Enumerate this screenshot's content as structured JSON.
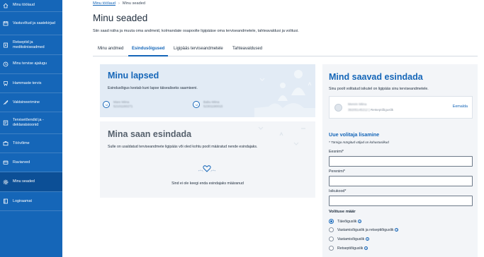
{
  "sidebar": {
    "items": [
      {
        "label": "Minu töölaud",
        "icon": "home-icon"
      },
      {
        "label": "Vastuvõtud ja saatekirjad",
        "icon": "calendar-icon"
      },
      {
        "label": "Retseptid ja meditsiiniseadmed",
        "icon": "prescription-icon"
      },
      {
        "label": "Minu tervise ajalugu",
        "icon": "history-icon"
      },
      {
        "label": "Hammaste tervis",
        "icon": "tooth-icon"
      },
      {
        "label": "Vaktsineerimine",
        "icon": "syringe-icon"
      },
      {
        "label": "Tervisetõendid ja -deklaratsioonid",
        "icon": "certificate-icon"
      },
      {
        "label": "Töövõime",
        "icon": "briefcase-icon"
      },
      {
        "label": "Raviarved",
        "icon": "invoice-icon"
      },
      {
        "label": "Minu seaded",
        "icon": "gear-icon",
        "active": true
      },
      {
        "label": "Logiraamat",
        "icon": "logbook-icon"
      }
    ]
  },
  "breadcrumb": {
    "home": "Minu töölaud",
    "current": "Minu seaded"
  },
  "page": {
    "title": "Minu seaded",
    "description": "Siin saad näha ja muuta oma andmeid, kolmandate osapoolte ligipääse oma terviseandmetele, tahteavaldusi ja volitusi."
  },
  "tabs": [
    {
      "label": "Minu andmed"
    },
    {
      "label": "Esindusõigused",
      "active": true
    },
    {
      "label": "Ligipääs terviseandmetele"
    },
    {
      "label": "Tahteavaldused"
    }
  ],
  "children_panel": {
    "title": "Minu lapsed",
    "subtitle": "Esindusõigus kestab kuni lapse täisealiseks saamiseni.",
    "children": [
      {
        "name": "Mare Miina",
        "code": "52101160271"
      },
      {
        "name": "Babu Miina",
        "code": "52301190015"
      }
    ]
  },
  "represent_panel": {
    "title": "Mina saan esindada",
    "subtitle": "Sulle on usaldatud terviseandmete ligipääs või oled kohtu poolt määratud nende esindajaks.",
    "empty_text": "Sind ei ole keegi enda esindajaks määranud"
  },
  "represented_by": {
    "title": "Mind saavad esindada",
    "subtitle": "Sinu poolt volitatud isikutel on ligipääs sinu terviseandmetele.",
    "person": {
      "name": "Merein Miina",
      "code": "39205145212",
      "role": "Retseptiõiguslik",
      "remove_label": "Eemalda"
    }
  },
  "add_form": {
    "title": "Uue volitaja lisamine",
    "required_note": "* Tärniga märgitud väljad on kohustuslikud",
    "first_name_label": "Eesnimi*",
    "first_name_value": "",
    "last_name_label": "Perenimi*",
    "last_name_value": "",
    "id_label": "Isikukood*",
    "id_value": "",
    "authority_title": "Volituse määr",
    "options": [
      {
        "label": "Täieõiguslik",
        "selected": true
      },
      {
        "label": "Vastamisõiguslik ja retseptiõiguslik",
        "selected": false
      },
      {
        "label": "Vastamisõiguslik",
        "selected": false
      },
      {
        "label": "Retseptiõiguslik",
        "selected": false
      }
    ]
  },
  "colors": {
    "primary": "#1566b8",
    "sidebar": "#1566b8",
    "panel_blue": "#e2ebf5",
    "panel_gray": "#f3f5f8"
  }
}
